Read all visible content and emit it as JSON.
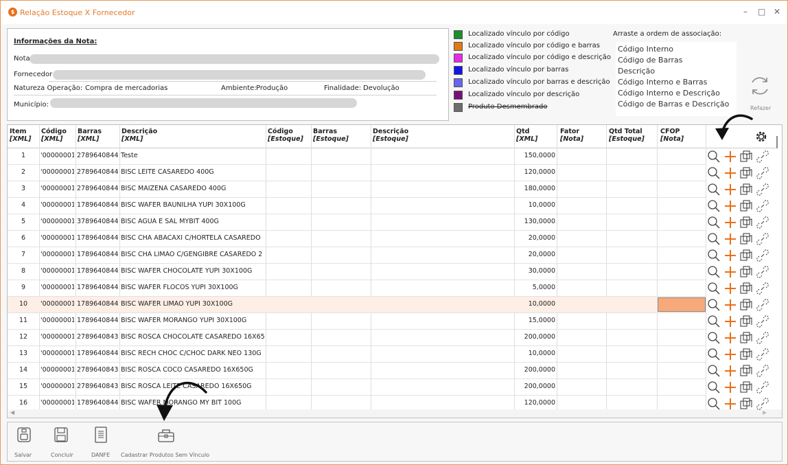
{
  "window": {
    "title": "Relação Estoque X Fornecedor",
    "min": "–",
    "max": "□",
    "close": "✕",
    "app_glyph": "$"
  },
  "info": {
    "heading": "Informações da Nota:",
    "nota_label": "Nota",
    "fornecedor_label": "Fornecedor",
    "natureza_label": "Natureza Operação:",
    "natureza_value": "Compra de mercadorias",
    "ambiente_label": "Ambiente:",
    "ambiente_value": "Produção",
    "finalidade_label": "Finalidade:",
    "finalidade_value": "Devolução",
    "municipio_label": "Município:"
  },
  "legend": [
    {
      "color": "#1a8f2a",
      "text": "Localizado vínculo por código"
    },
    {
      "color": "#e07a16",
      "text": "Localizado vínculo por código e barras"
    },
    {
      "color": "#e62be6",
      "text": "Localizado vínculo por código e descrição"
    },
    {
      "color": "#1414e6",
      "text": "Localizado vínculo por barras"
    },
    {
      "color": "#6666ee",
      "text": "Localizado vínculo por barras e descrição"
    },
    {
      "color": "#7a0f7a",
      "text": "Localizado vínculo por descrição"
    },
    {
      "color": "#6e6e6e",
      "text": "Produto Desmembrado"
    }
  ],
  "order": {
    "title": "Arraste a ordem de associação:",
    "items": [
      "Código Interno",
      "Código de Barras",
      "Descrição",
      "Código Interno e Barras",
      "Código Interno e Descrição",
      "Código de Barras e Descrição"
    ]
  },
  "refazer_label": "Refazer",
  "columns": [
    {
      "l1": "Item",
      "l2": "[XML]"
    },
    {
      "l1": "Código",
      "l2": "[XML]"
    },
    {
      "l1": "Barras",
      "l2": "[XML]"
    },
    {
      "l1": "Descrição",
      "l2": "[XML]"
    },
    {
      "l1": "Código",
      "l2": "[Estoque]"
    },
    {
      "l1": "Barras",
      "l2": "[Estoque]"
    },
    {
      "l1": "Descrição",
      "l2": "[Estoque]"
    },
    {
      "l1": "Qtd",
      "l2": "[XML]"
    },
    {
      "l1": "Fator",
      "l2": "[Nota]"
    },
    {
      "l1": "Qtd Total",
      "l2": "[Estoque]"
    },
    {
      "l1": "CFOP",
      "l2": "[Nota]"
    }
  ],
  "rows": [
    {
      "item": "1",
      "codigo": "'00000001",
      "barras": "2789640844",
      "descricao": "Teste",
      "qtd": "150,0000"
    },
    {
      "item": "2",
      "codigo": "'00000001",
      "barras": "2789640844",
      "descricao": "BISC LEITE CASAREDO 400G",
      "qtd": "120,0000"
    },
    {
      "item": "3",
      "codigo": "'00000001",
      "barras": "2789640844",
      "descricao": "BISC MAIZENA CASAREDO 400G",
      "qtd": "180,0000"
    },
    {
      "item": "4",
      "codigo": "'00000001",
      "barras": "1789640844",
      "descricao": "BISC WAFER BAUNILHA YUPI 30X100G",
      "qtd": "10,0000"
    },
    {
      "item": "5",
      "codigo": "'00000001",
      "barras": "3789640844",
      "descricao": "BISC AGUA E SAL MYBIT 400G",
      "qtd": "130,0000"
    },
    {
      "item": "6",
      "codigo": "'00000001",
      "barras": "1789640844",
      "descricao": "BISC CHA ABACAXI C/HORTELA CASAREDO",
      "qtd": "20,0000"
    },
    {
      "item": "7",
      "codigo": "'00000001",
      "barras": "1789640844",
      "descricao": "BISC CHA LIMAO C/GENGIBRE CASAREDO 2",
      "qtd": "20,0000"
    },
    {
      "item": "8",
      "codigo": "'00000001",
      "barras": "1789640844",
      "descricao": "BISC WAFER CHOCOLATE YUPI 30X100G",
      "qtd": "30,0000"
    },
    {
      "item": "9",
      "codigo": "'00000001",
      "barras": "1789640844",
      "descricao": "BISC WAFER FLOCOS YUPI 30X100G",
      "qtd": "5,0000"
    },
    {
      "item": "10",
      "codigo": "'00000001",
      "barras": "1789640844",
      "descricao": "BISC WAFER LIMAO YUPI 30X100G",
      "qtd": "10,0000"
    },
    {
      "item": "11",
      "codigo": "'00000001",
      "barras": "1789640844",
      "descricao": "BISC WAFER MORANGO YUPI 30X100G",
      "qtd": "15,0000"
    },
    {
      "item": "12",
      "codigo": "'00000001",
      "barras": "2789640843",
      "descricao": "BISC ROSCA CHOCOLATE CASAREDO 16X65",
      "qtd": "200,0000"
    },
    {
      "item": "13",
      "codigo": "'00000001",
      "barras": "1789640844",
      "descricao": "BISC RECH CHOC C/CHOC DARK NEO 130G",
      "qtd": "10,0000"
    },
    {
      "item": "14",
      "codigo": "'00000001",
      "barras": "2789640843",
      "descricao": "BISC ROSCA COCO CASAREDO 16X650G",
      "qtd": "200,0000"
    },
    {
      "item": "15",
      "codigo": "'00000001",
      "barras": "2789640843",
      "descricao": "BISC ROSCA LEITE CASAREDO 16X650G",
      "qtd": "200,0000"
    },
    {
      "item": "16",
      "codigo": "'00000001",
      "barras": "1789640844",
      "descricao": "BISC WAFER MORANGO MY BIT 100G",
      "qtd": "120,0000"
    }
  ],
  "selected_row": 10,
  "cfop_highlight_color": "#f7a97a",
  "toolbar": {
    "salvar": "Salvar",
    "concluir": "Concluir",
    "danfe": "DANFE",
    "cadastrar": "Cadastrar Produtos Sem Vínculo"
  },
  "accent": "#e8701a"
}
